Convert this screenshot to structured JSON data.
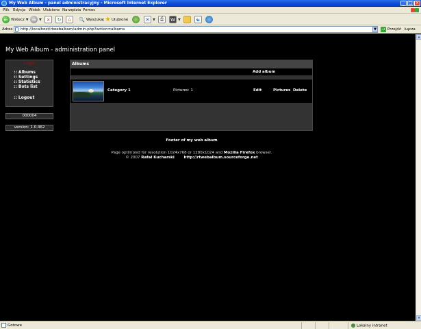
{
  "window": {
    "title": "My Web Album - panel administracyjny - Microsoft Internet Explorer",
    "controls": [
      "_",
      "□",
      "×"
    ]
  },
  "menu": [
    "Plik",
    "Edycja",
    "Widok",
    "Ulubione",
    "Narzędzia",
    "Pomoc"
  ],
  "toolbar": {
    "back_label": "Wstecz",
    "search_label": "Wyszukaj",
    "favorites_label": "Ulubione"
  },
  "address": {
    "label": "Adres",
    "url": "http://localhost/rtwebalbum/admin.php?action=albums",
    "go_label": "Przejdź",
    "links_label": "Łącza"
  },
  "page": {
    "heading": "My Web Album - administration panel",
    "sidebar": {
      "user": "Login",
      "nav": [
        ":: Albums",
        ":: Settings",
        ":: Statistics",
        ":: Bots list"
      ],
      "logout": ":: Logout"
    },
    "counter": "000004",
    "version": "version: 1.0.462",
    "content": {
      "header": "Albums",
      "add_album": "Add album",
      "albums": [
        {
          "name": "Category 1",
          "pictures": "Pictures: 1",
          "edit": "Edit",
          "pictures_link": "Pictures",
          "delete": "Delete"
        }
      ]
    },
    "footer": {
      "title": "Footer of my web album",
      "line1_pre": "Page optimized for resolution 1024x768 or 1280x1024 and ",
      "line1_bold": "Mozilla Firefox",
      "line1_post": " browser.",
      "copyright_pre": "© 2007 ",
      "author": "Rafał Kucharski",
      "site": "http://rtwebalbum.sourceforge.net"
    }
  },
  "status": {
    "text": "Gotowe",
    "zone": "Lokalny intranet"
  }
}
